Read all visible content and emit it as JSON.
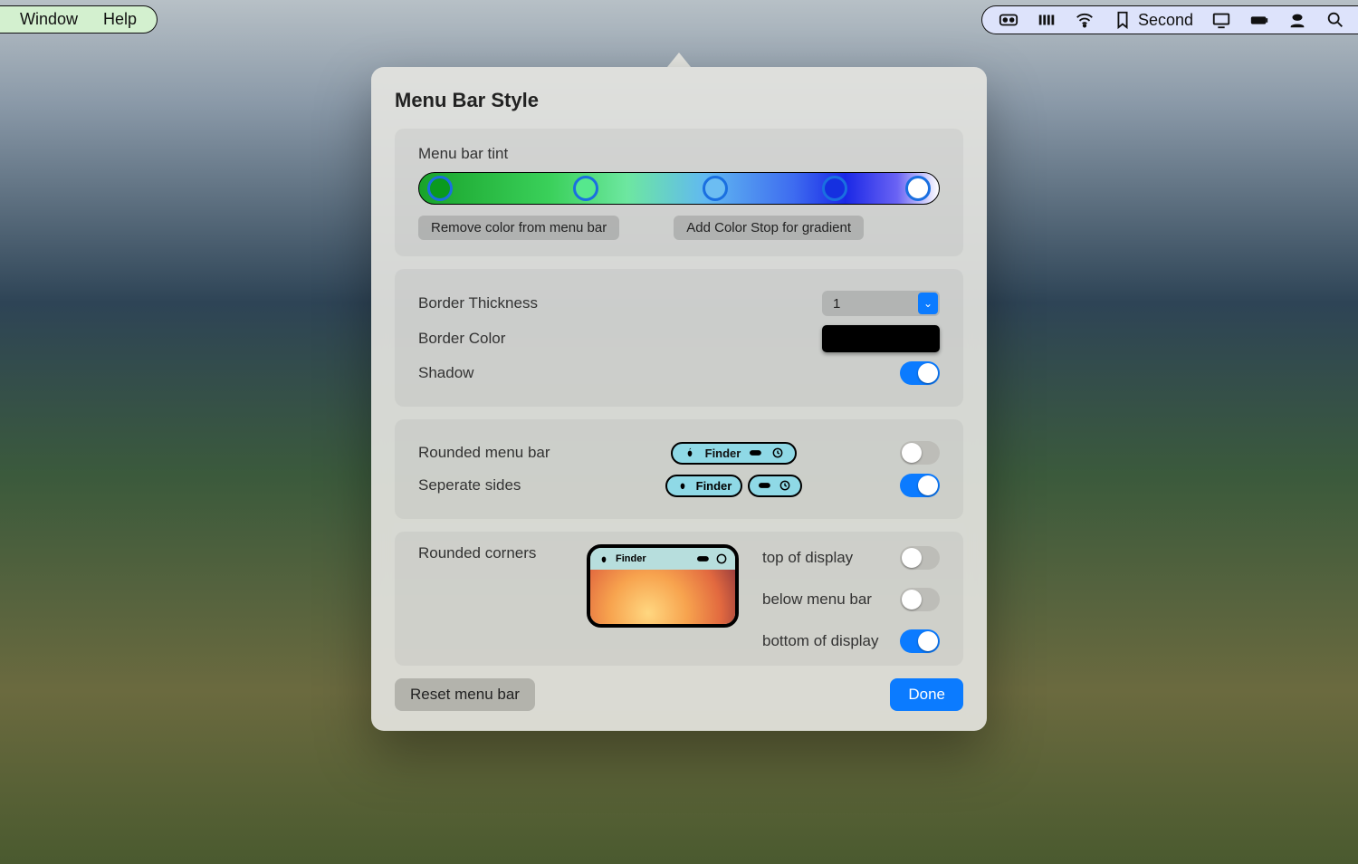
{
  "menubar_left": {
    "items": [
      "Window",
      "Help"
    ]
  },
  "menubar_right": {
    "second_label": "Second"
  },
  "panel": {
    "title": "Menu Bar Style",
    "tint": {
      "label": "Menu bar tint",
      "remove_btn": "Remove color from menu bar",
      "add_stop_btn": "Add Color Stop for gradient",
      "stops": [
        {
          "pos": 4,
          "color": "#0a9a1f"
        },
        {
          "pos": 32,
          "color": "#56e88d"
        },
        {
          "pos": 57,
          "color": "#6cbdf2"
        },
        {
          "pos": 80,
          "color": "#1530e0"
        },
        {
          "pos": 96,
          "color": "#ffffff"
        }
      ]
    },
    "border": {
      "thickness_label": "Border Thickness",
      "thickness_value": "1",
      "color_label": "Border Color",
      "color_value": "#000000",
      "shadow_label": "Shadow",
      "shadow_on": true
    },
    "rounded": {
      "rounded_label": "Rounded menu bar",
      "rounded_on": false,
      "separate_label": "Seperate sides",
      "separate_on": true,
      "preview_app": "Finder"
    },
    "corners": {
      "label": "Rounded corners",
      "preview_app": "Finder",
      "top_label": "top of display",
      "top_on": false,
      "below_label": "below menu bar",
      "below_on": false,
      "bottom_label": "bottom of display",
      "bottom_on": true
    },
    "footer": {
      "reset": "Reset menu bar",
      "done": "Done"
    }
  }
}
